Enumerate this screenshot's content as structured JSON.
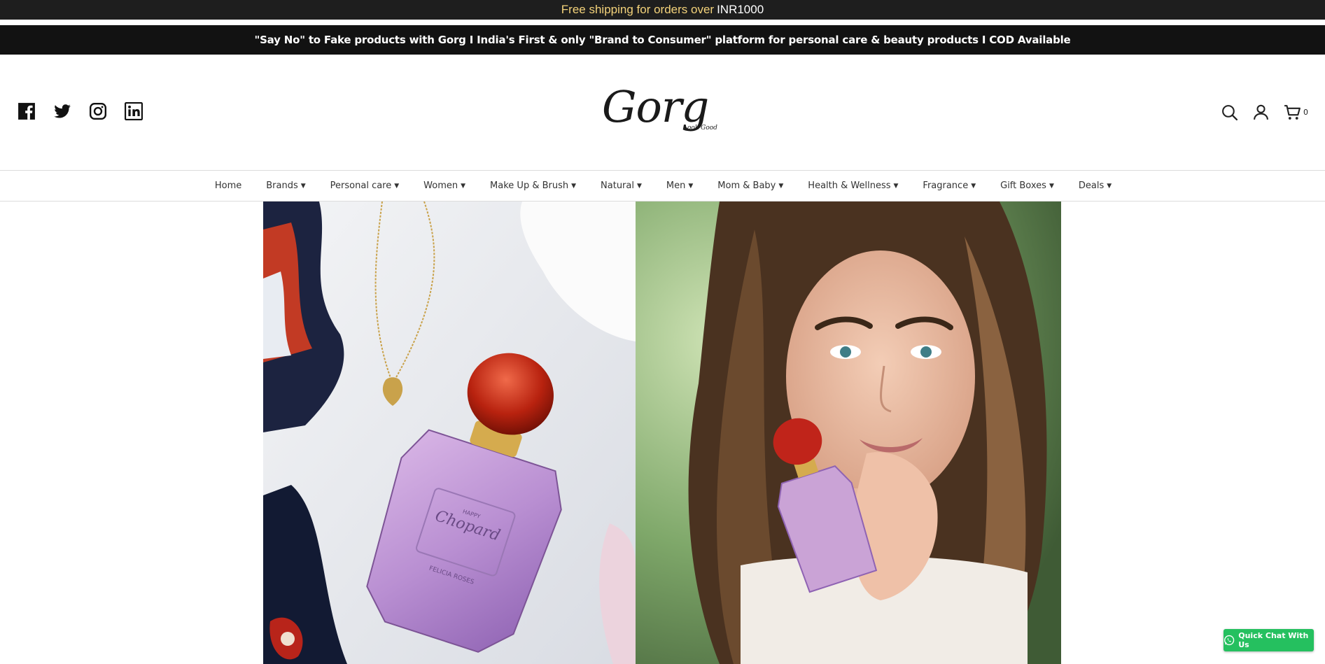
{
  "topbar": {
    "text": "Free shipping for orders over",
    "amount": "INR1000"
  },
  "announcement": {
    "text": "\"Say No\" to Fake products with Gorg I India's First & only \"Brand to Consumer\" platform for personal care & beauty products I COD Available"
  },
  "header": {
    "social_icons": [
      "facebook-icon",
      "twitter-icon",
      "instagram-icon",
      "linkedin-icon"
    ],
    "logo": {
      "main": "Gorg",
      "tagline": "Look Good"
    },
    "tools": {
      "icons": [
        "search-icon",
        "account-icon",
        "cart-icon"
      ],
      "cart_count": "0"
    }
  },
  "nav": {
    "items": [
      {
        "label": "Home",
        "dropdown": false
      },
      {
        "label": "Brands",
        "dropdown": true
      },
      {
        "label": "Personal care",
        "dropdown": true
      },
      {
        "label": "Women",
        "dropdown": true
      },
      {
        "label": "Make Up & Brush",
        "dropdown": true
      },
      {
        "label": "Natural",
        "dropdown": true
      },
      {
        "label": "Men",
        "dropdown": true
      },
      {
        "label": "Mom & Baby",
        "dropdown": true
      },
      {
        "label": "Health & Wellness",
        "dropdown": true
      },
      {
        "label": "Fragrance",
        "dropdown": true
      },
      {
        "label": "Gift Boxes",
        "dropdown": true
      },
      {
        "label": "Deals",
        "dropdown": true
      }
    ]
  },
  "hero": {
    "product_brand": "Chopard",
    "product_line": "HAPPY",
    "product_name": "FELICIA ROSES"
  },
  "chat": {
    "label": "Quick Chat With Us",
    "icon": "whatsapp-icon"
  },
  "colors": {
    "topbar_bg": "#1e1e1e",
    "topbar_text": "#f3d27a",
    "announce_bg": "#121212",
    "chat_green": "#25c05f"
  }
}
